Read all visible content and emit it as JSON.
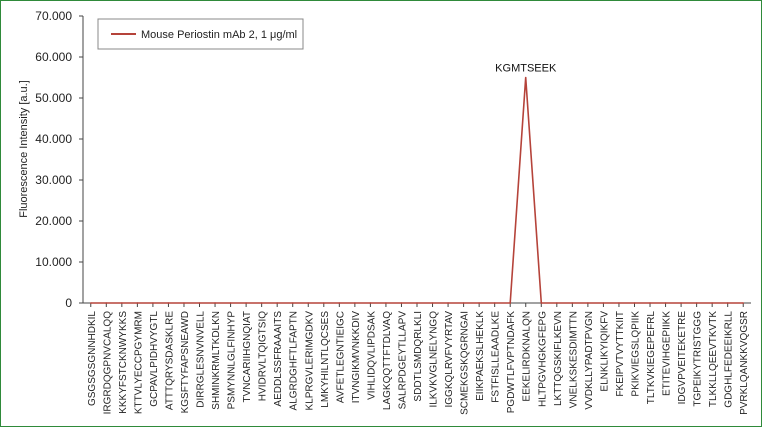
{
  "chart_data": {
    "type": "line",
    "ylabel": "Fluorescence Intensity [a.u.]",
    "xlabel": "",
    "ylim": [
      0,
      70000
    ],
    "ytick_labels": [
      "0",
      "10.000",
      "20.000",
      "30.000",
      "40.000",
      "50.000",
      "60.000",
      "70.000"
    ],
    "ytick_values": [
      0,
      10000,
      20000,
      30000,
      40000,
      50000,
      60000,
      70000
    ],
    "grid": false,
    "legend_position": "top-left",
    "categories": [
      "GSGSGSGNNHDKIL",
      "IRGRDQGPNVCALQQ",
      "KKKYFSTCKNWYKKS",
      "KTTVLYECCPGYMRM",
      "GCPAVLPIDHVYGTL",
      "ATTTQRYSDASKLRE",
      "KGSFTYFAPSNEAWD",
      "DIRRGLESNVNVELL",
      "SHMINKRMLTKDLKN",
      "PSMYNNLGLFINHYP",
      "TVNCARIIHGNQIAT",
      "HVIDRVLTQIGTSIQ",
      "AEDDLSSFRAAAITS",
      "ALGRDGHFTLFAPTN",
      "KLPRGVLERIMGDKV",
      "LMKYHILNTLQCSES",
      "AVFETLEGNTIEIGC",
      "ITVNGIKMVNKKDIV",
      "VIHLIDQVLIPDSAK",
      "LAGKQQTTFTDLVAQ",
      "SALRPDGEYTLLAPV",
      "SDDTLSMDQRLKLI",
      "ILKVKVGLNELYNGQ",
      "IGGKQLRVFVYRTAV",
      "SCMEKGSKQGRNGAI",
      "EIIKPAEKSLHEKLK",
      "FSTFISLLEAADLKE",
      "PGDWTLFVPTNDAFK",
      "EEKELIRDKNALQN",
      "HLTPGVHGKGFEPG",
      "LKTTQGSKIFLKEVN",
      "VNELKSKESDIMTTN",
      "VVDKLLYPADTPVGN",
      "ELNKLIKYIQIKFV",
      "FKEIPVTVYTTKIIT",
      "PKIKVIEGSLQPIIK",
      "TLTKVKIEGEPEFRL",
      "ETITEVIHGEPIIKK",
      "IDGVPVEITEKETRE",
      "TGPEIKYTRISTGGG",
      "TLKKLLQEEVTKVTK",
      "GDGHLFEDEEIKRLL",
      "PVRKLQANKKVQGSR"
    ],
    "series": [
      {
        "name": "Mouse Periostin mAb 2, 1 μg/ml",
        "color": "#b5433a",
        "values": [
          0,
          0,
          0,
          0,
          0,
          0,
          0,
          0,
          0,
          0,
          0,
          0,
          0,
          0,
          0,
          0,
          0,
          0,
          0,
          0,
          0,
          0,
          0,
          0,
          0,
          0,
          0,
          0,
          55000,
          0,
          0,
          0,
          0,
          0,
          0,
          0,
          0,
          0,
          0,
          0,
          0,
          0,
          0
        ]
      }
    ],
    "annotations": [
      {
        "text": "KGMTSEEK",
        "category_index": 28,
        "value": 55000
      }
    ]
  }
}
